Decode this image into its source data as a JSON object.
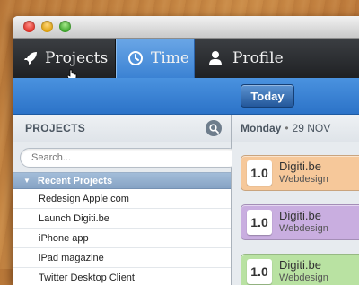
{
  "nav": {
    "tabs": [
      {
        "label": "Projects",
        "icon": "rocket-icon"
      },
      {
        "label": "Time",
        "icon": "clock-icon",
        "active": true
      },
      {
        "label": "Profile",
        "icon": "person-icon"
      }
    ]
  },
  "toolbar": {
    "today_label": "Today"
  },
  "sidebar": {
    "header": "PROJECTS",
    "search_placeholder": "Search...",
    "group_label": "Recent Projects",
    "projects": [
      "Redesign Apple.com",
      "Launch Digiti.be",
      "iPhone app",
      "iPad magazine",
      "Twitter Desktop Client"
    ]
  },
  "main": {
    "day": "Monday",
    "date": "29 NOV",
    "entries": [
      {
        "hours": "1.0",
        "client": "Digiti.be",
        "project": "Webdesign",
        "color": "#f6c89a"
      },
      {
        "hours": "1.0",
        "client": "Digiti.be",
        "project": "Webdesign",
        "color": "#c9aee0"
      },
      {
        "hours": "1.0",
        "client": "Digiti.be",
        "project": "Webdesign",
        "color": "#b9e2a2"
      }
    ]
  },
  "colors": {
    "accent": "#3b82d3",
    "nav_dark": "#1f2124"
  }
}
